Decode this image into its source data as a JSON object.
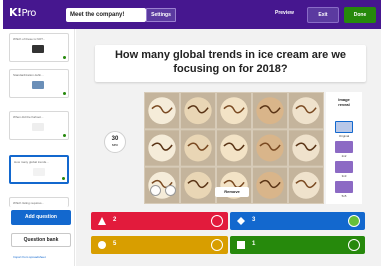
{
  "header": {
    "logo_main": "K!",
    "logo_suffix": "Pro",
    "kahoot_title": "Meet the company!",
    "settings_label": "Settings",
    "preview_label": "Preview",
    "exit_label": "Exit",
    "done_label": "Done"
  },
  "sidebar": {
    "slides": [
      {
        "title": "Which of these is NOT..."
      },
      {
        "title": "Standardization defin..."
      },
      {
        "title": "When did the Kahoot..."
      },
      {
        "title": "How many global trends..."
      },
      {
        "title": "Which listing requires..."
      }
    ],
    "add_question_label": "Add question",
    "question_bank_label": "Question bank",
    "import_label": "Import from spreadsheet"
  },
  "main": {
    "question": "How many global trends in ice cream are we focusing on for 2018?",
    "timer_value": "30",
    "timer_unit": "sec",
    "remove_label": "Remove",
    "image_reveal": {
      "title_line1": "Image",
      "title_line2": "reveal",
      "options": [
        {
          "label": "Original"
        },
        {
          "label": "2x2"
        },
        {
          "label": "3x3"
        },
        {
          "label": "5x5"
        }
      ]
    },
    "answers": [
      {
        "text": "2",
        "color": "#e21b3c",
        "shape": "triangle",
        "correct": false
      },
      {
        "text": "3",
        "color": "#1368ce",
        "shape": "diamond",
        "correct": true
      },
      {
        "text": "5",
        "color": "#d89e00",
        "shape": "circle",
        "correct": false
      },
      {
        "text": "1",
        "color": "#26890c",
        "shape": "square",
        "correct": false
      }
    ]
  },
  "colors": {
    "brand_purple": "#46178f",
    "button_blue": "#1368ce",
    "done_green": "#26890c"
  }
}
